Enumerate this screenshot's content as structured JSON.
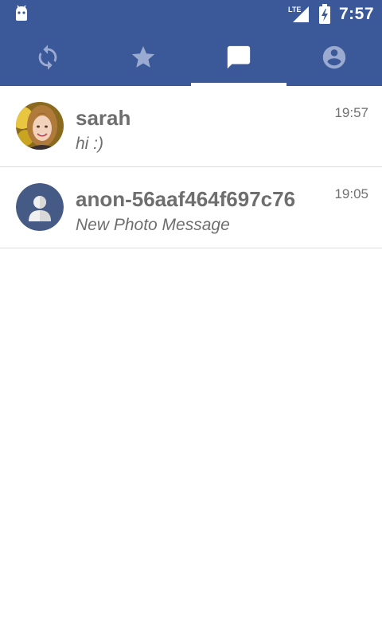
{
  "status_bar": {
    "time": "7:57",
    "network_label": "LTE",
    "icons": [
      "android-icon",
      "lte-signal-icon",
      "battery-charging-icon"
    ]
  },
  "tabs": [
    {
      "name": "sync",
      "icon": "sync-icon",
      "active": false
    },
    {
      "name": "favorites",
      "icon": "star-icon",
      "active": false
    },
    {
      "name": "messages",
      "icon": "chat-bubble-icon",
      "active": true
    },
    {
      "name": "profile",
      "icon": "account-icon",
      "active": false
    }
  ],
  "colors": {
    "brand": "#3b5998",
    "inactive_tab_icon": "#9aaad0",
    "active_tab_icon": "#ffffff",
    "text": "#6e6e6e",
    "divider": "#dcdcdc"
  },
  "conversations": [
    {
      "name": "sarah",
      "preview": "hi :)",
      "time": "19:57",
      "avatar": "photo-avatar"
    },
    {
      "name": "anon-56aaf464f697c76",
      "preview": "New Photo Message",
      "time": "19:05",
      "avatar": "default-avatar-icon"
    }
  ]
}
